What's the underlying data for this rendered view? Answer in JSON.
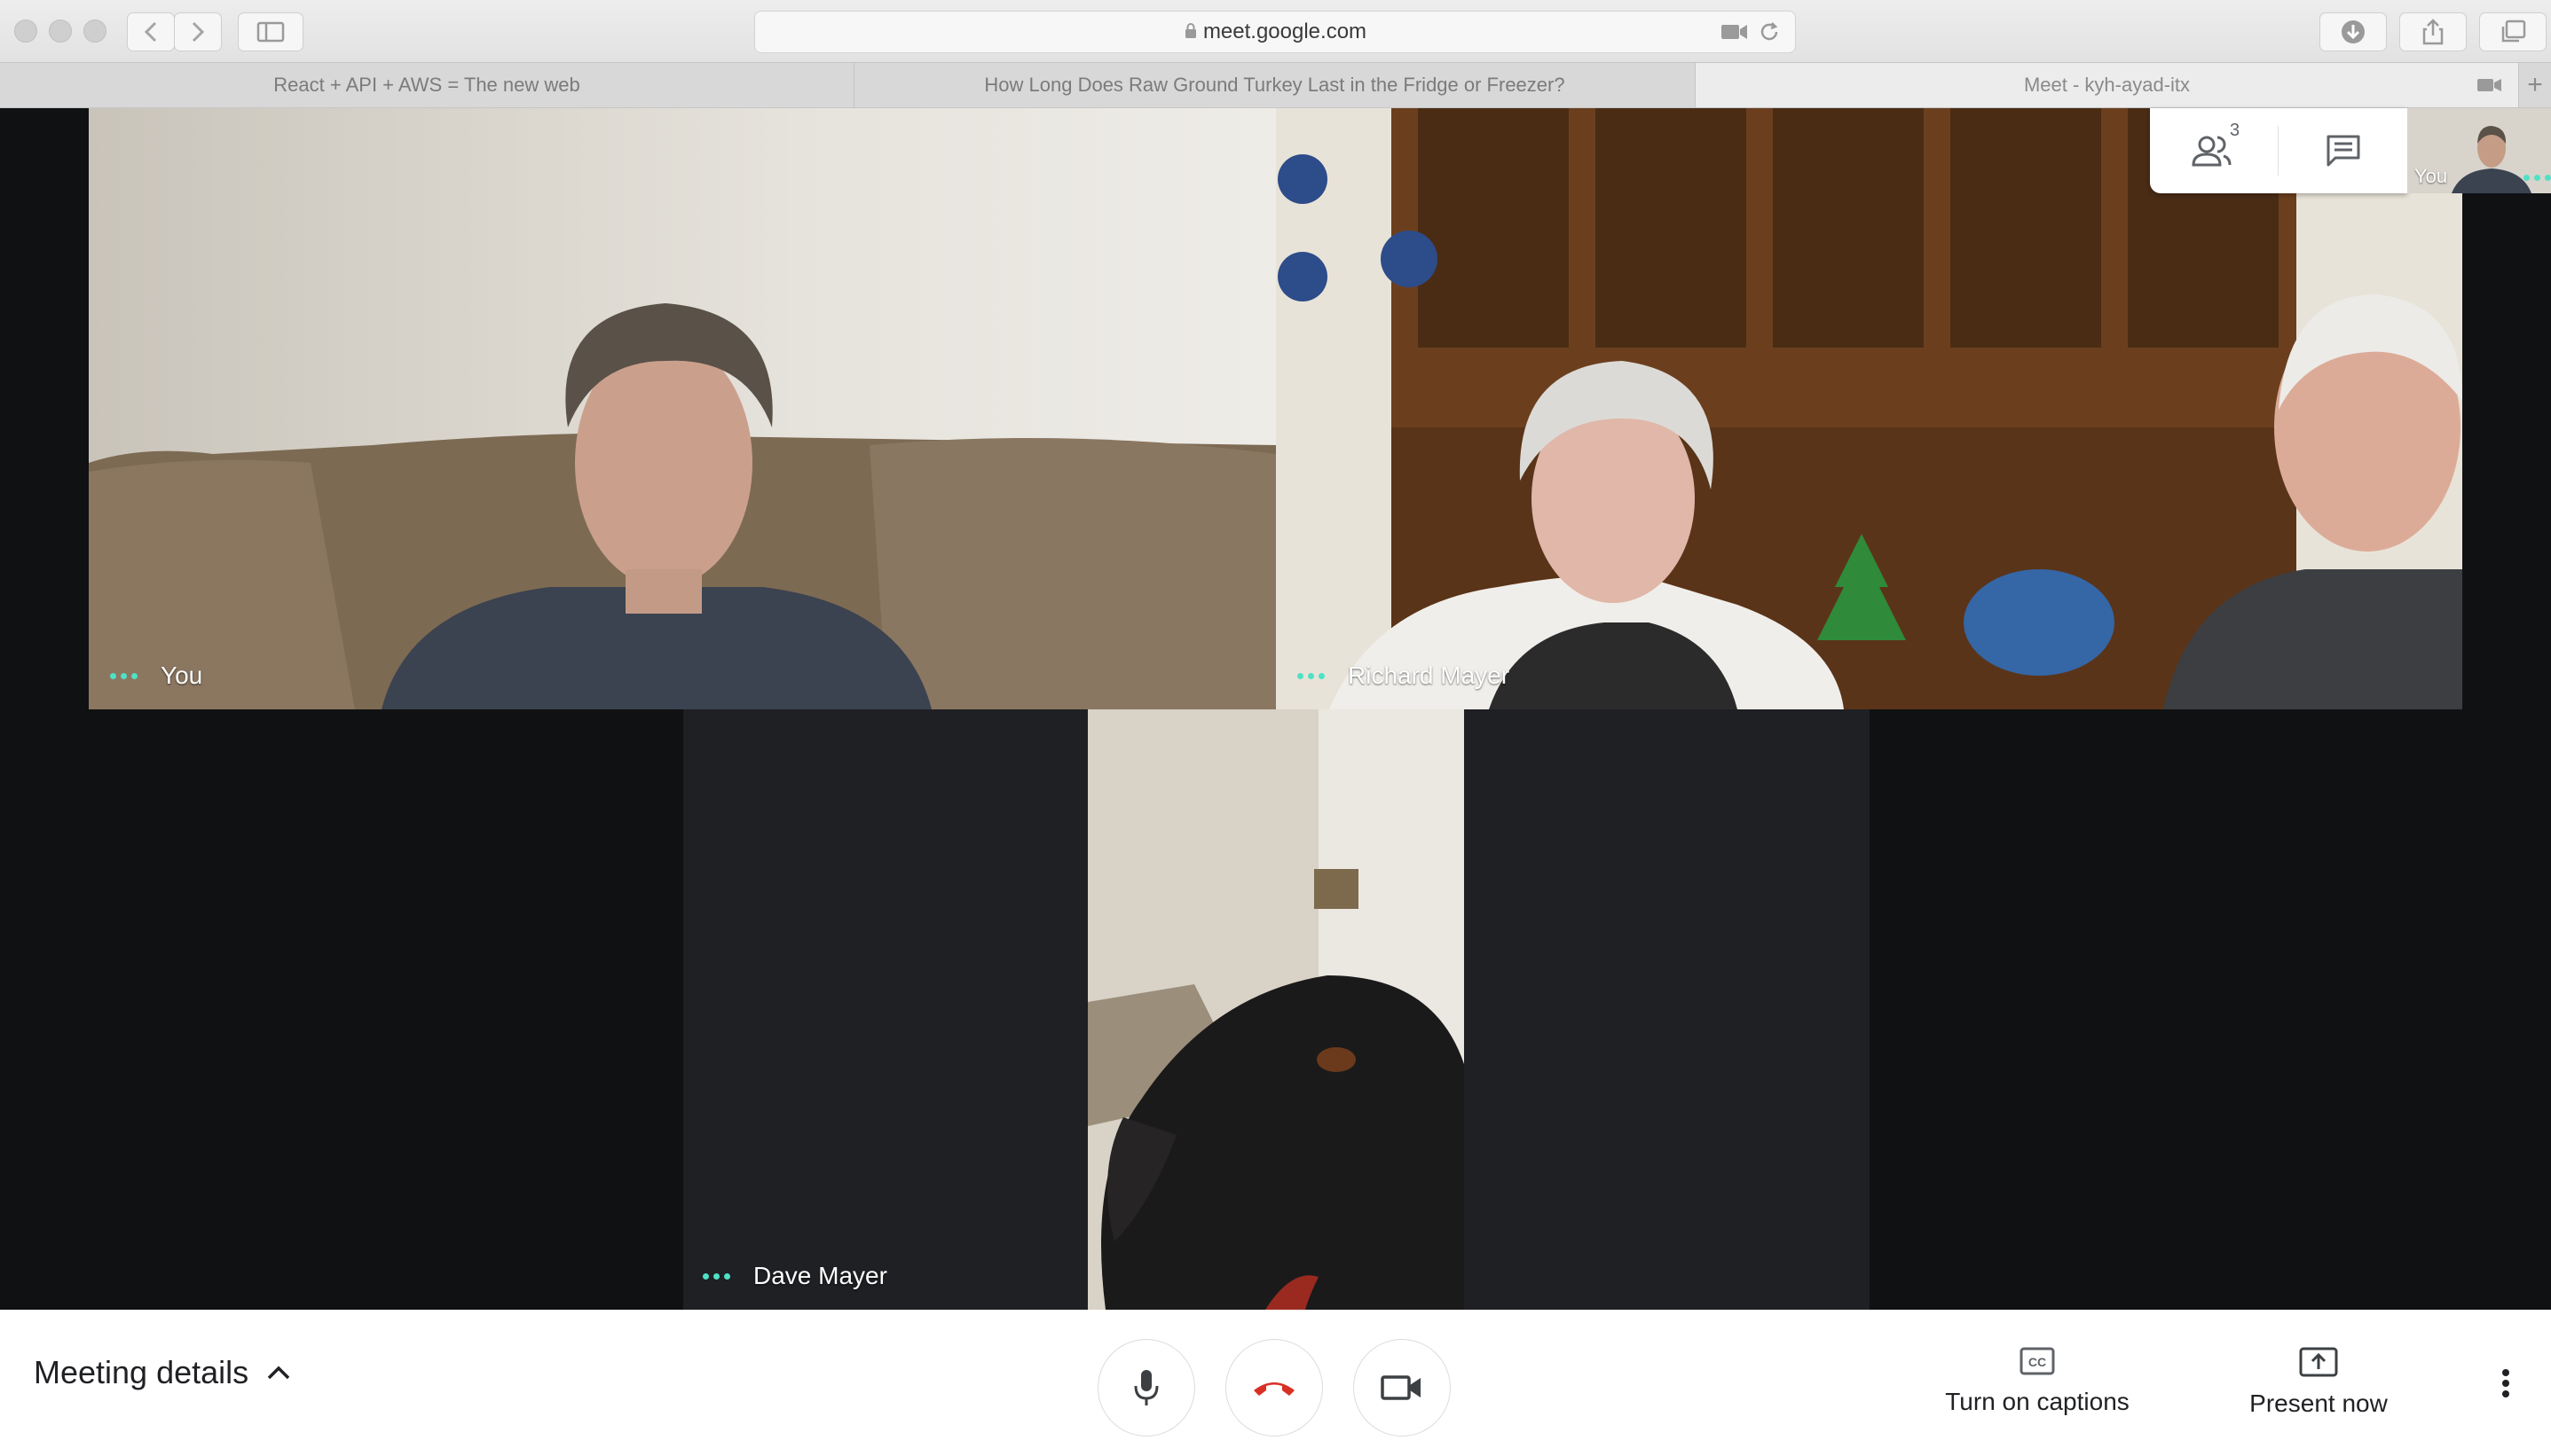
{
  "browser": {
    "url": "meet.google.com",
    "tabs": [
      {
        "label": "React + API + AWS = The new web",
        "active": false
      },
      {
        "label": "How Long Does Raw Ground Turkey Last in the Fridge or Freezer?",
        "active": false
      },
      {
        "label": "Meet - kyh-ayad-itx",
        "active": true
      }
    ]
  },
  "meet": {
    "participants_count": "3",
    "self_thumb_label": "You",
    "tiles": [
      {
        "name": "You"
      },
      {
        "name": "Richard Mayer"
      },
      {
        "name": "Dave Mayer"
      }
    ]
  },
  "controls": {
    "meeting_details_label": "Meeting details",
    "captions_label": "Turn on captions",
    "present_label": "Present now"
  },
  "colors": {
    "speaking_dots": "#4ee1c6",
    "hangup_red": "#d93025",
    "stage_bg": "#101112"
  }
}
